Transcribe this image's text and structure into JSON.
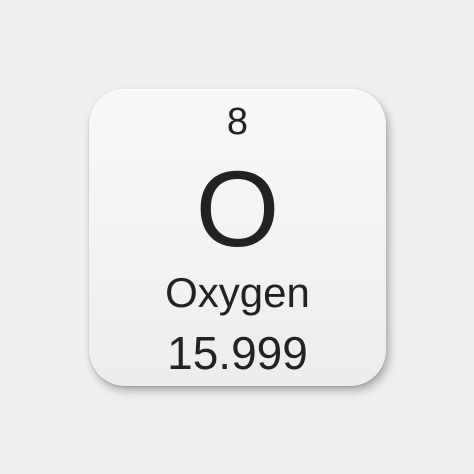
{
  "element": {
    "atomic_number": "8",
    "symbol": "O",
    "name": "Oxygen",
    "atomic_mass": "15.999"
  },
  "colors": {
    "background": "#efefef",
    "tile": "#f4f4f4",
    "text": "#222222"
  }
}
